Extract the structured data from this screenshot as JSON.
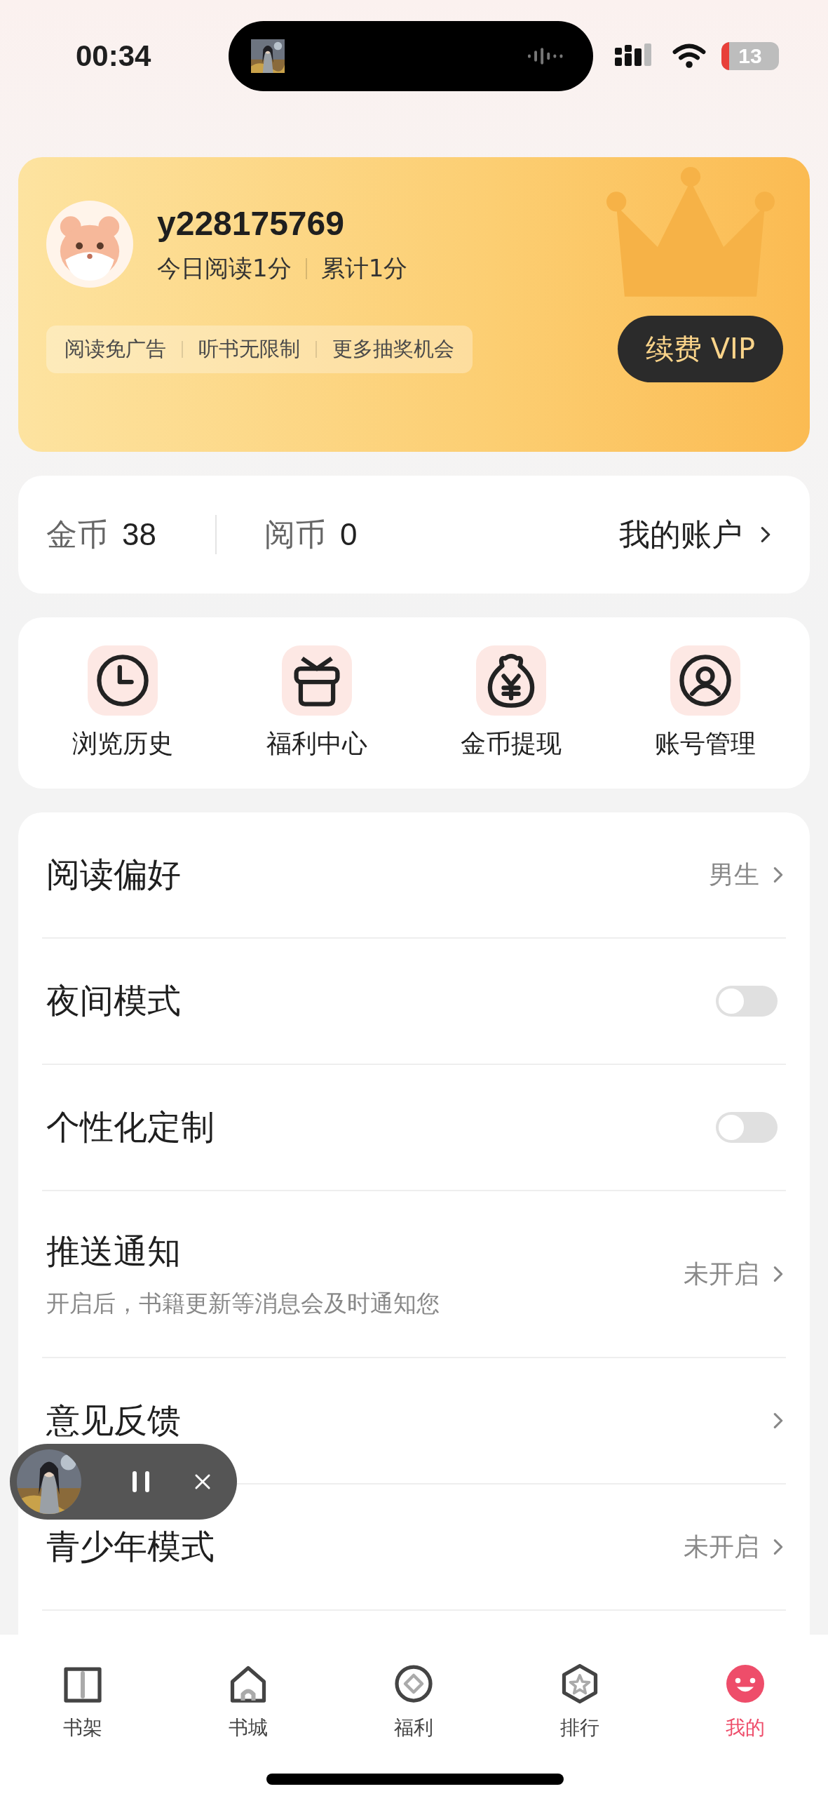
{
  "status_bar": {
    "time": "00:34",
    "battery": "13"
  },
  "profile": {
    "username": "y228175769",
    "stats": [
      "今日阅读1分",
      "累计1分"
    ],
    "perks": [
      "阅读免广告",
      "听书无限制",
      "更多抽奖机会"
    ],
    "vip_button": "续费 VIP"
  },
  "wallet": {
    "items": [
      {
        "label": "金币",
        "value": "38"
      },
      {
        "label": "阅币",
        "value": "0"
      }
    ],
    "account_link": "我的账户"
  },
  "shortcuts": [
    {
      "label": "浏览历史",
      "kind": "clock"
    },
    {
      "label": "福利中心",
      "kind": "gift"
    },
    {
      "label": "金币提现",
      "kind": "moneybag"
    },
    {
      "label": "账号管理",
      "kind": "person"
    }
  ],
  "settings": [
    {
      "kind": "link",
      "label": "阅读偏好",
      "value": "男生"
    },
    {
      "kind": "toggle",
      "label": "夜间模式",
      "on": false
    },
    {
      "kind": "toggle",
      "label": "个性化定制",
      "on": false
    },
    {
      "kind": "link",
      "label": "推送通知",
      "value": "未开启",
      "subtitle": "开启后，书籍更新等消息会及时通知您"
    },
    {
      "kind": "link",
      "label": "意见反馈"
    },
    {
      "kind": "link",
      "label": "青少年模式",
      "value": "未开启"
    }
  ],
  "tabs": [
    {
      "label": "书架",
      "kind": "book",
      "selected": false
    },
    {
      "label": "书城",
      "kind": "house",
      "selected": false
    },
    {
      "label": "福利",
      "kind": "coin",
      "selected": false
    },
    {
      "label": "排行",
      "kind": "star",
      "selected": false
    },
    {
      "label": "我的",
      "kind": "face",
      "selected": true
    }
  ]
}
